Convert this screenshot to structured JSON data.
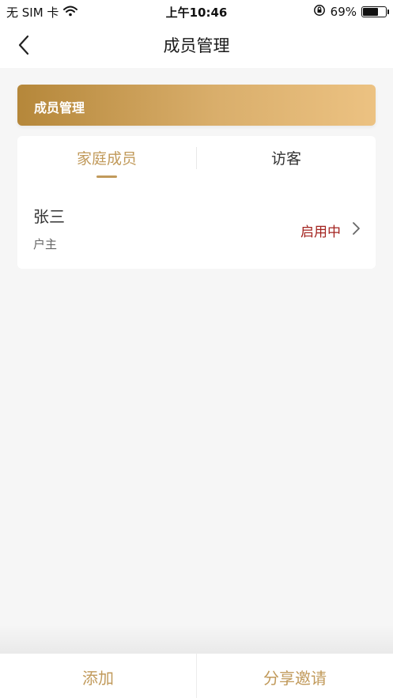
{
  "status_bar": {
    "carrier": "无 SIM 卡",
    "time": "上午10:46",
    "battery_percent": "69%",
    "battery_level": 0.69,
    "icons": [
      "wifi-icon",
      "rotation-lock-icon",
      "battery-icon"
    ]
  },
  "nav": {
    "title": "成员管理",
    "back_icon": "chevron-left-icon"
  },
  "banner": {
    "title": "成员管理"
  },
  "tabs": [
    {
      "label": "家庭成员",
      "active": true
    },
    {
      "label": "访客",
      "active": false
    }
  ],
  "members": [
    {
      "name": "张三",
      "role": "户主",
      "status": "启用中"
    }
  ],
  "bottom": {
    "add_label": "添加",
    "share_label": "分享邀请"
  },
  "colors": {
    "accent": "#c19a5b",
    "status_active": "#a3231f",
    "banner_start": "#b5873a",
    "banner_end": "#ecc282",
    "background": "#f6f6f6"
  }
}
